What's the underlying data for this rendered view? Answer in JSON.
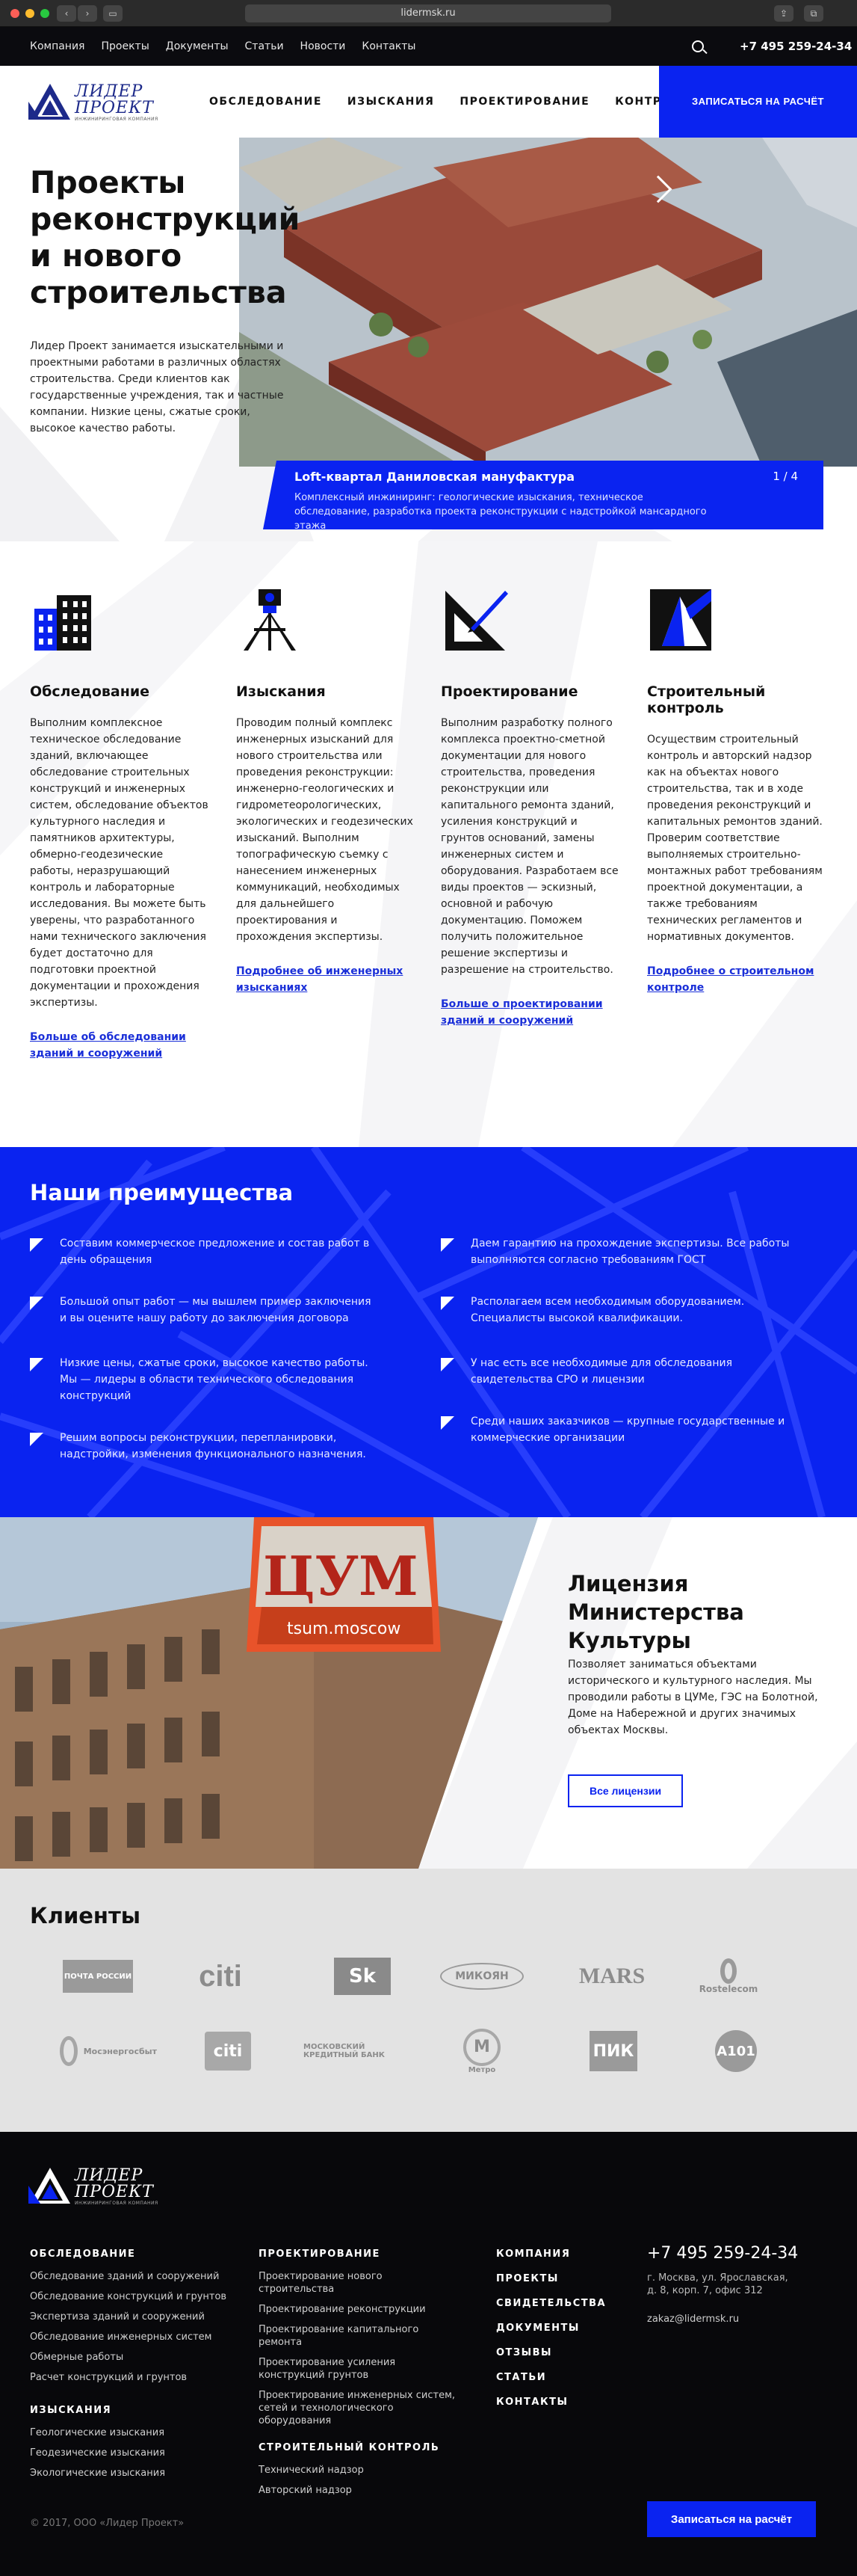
{
  "browser": {
    "url": "lidermsk.ru"
  },
  "topbar": {
    "nav": [
      "Компания",
      "Проекты",
      "Документы",
      "Статьи",
      "Новости",
      "Контакты"
    ],
    "phone": "+7 495 259-24-34"
  },
  "header": {
    "logo_line1": "ЛИДЕР",
    "logo_line2": "ПРОЕКТ",
    "logo_tagline": "ИНЖИНИРИНГОВАЯ КОМПАНИЯ",
    "nav": [
      "ОБСЛЕДОВАНИЕ",
      "ИЗЫСКАНИЯ",
      "ПРОЕКТИРОВАНИЕ",
      "КОНТРОЛЬ"
    ],
    "cta": "ЗАПИСАТЬСЯ НА РАСЧЁТ"
  },
  "hero": {
    "title": "Проекты реконструкций и нового строительства",
    "text": "Лидер Проект занимается изыскательными и проектными работами в различных областях строительства. Среди клиентов как государственные учреждения, так и частные компании. Низкие цены, сжатые сроки, высокое качество работы.",
    "slide_title": "Loft-квартал Даниловская мануфактура",
    "slide_counter": "1 / 4",
    "slide_text": "Комплексный инжиниринг: геологические изыскания, техническое обследование, разработка проекта реконструкции с надстройкой мансардного этажа"
  },
  "services": [
    {
      "icon": "building-icon",
      "title": "Обследование",
      "text": "Выполним комплексное техническое обследование зданий, включающее обследование строительных конструкций и инженерных систем, обследование объектов культурного наследия и памятников архитектуры, обмерно-геодезические работы, неразрушающий контроль и лабораторные исследования. Вы можете быть уверены, что разработанного нами технического заключения будет достаточно для подготовки проектной документации и прохождения экспертизы.",
      "link": "Больше об обследовании зданий и сооружений"
    },
    {
      "icon": "theodolite-icon",
      "title": "Изыскания",
      "text": "Проводим полный комплекс инженерных изысканий для нового строительства или проведения реконструкции: инженерно-геологических и гидрометеорологических, экологических и геодезических изысканий. Выполним топографическую съемку с нанесением инженерных коммуникаций, необходимых для дальнейшего проектирования и прохождения экспертизы.",
      "link": "Подробнее об инженерных изысканиях"
    },
    {
      "icon": "set-square-icon",
      "title": "Проектирование",
      "text": "Выполним разработку полного комплекса проектно-сметной документации для нового строительства, проведения реконструкции или капитального ремонта зданий, усиления конструкций и грунтов оснований, замены инженерных систем и оборудования. Разработаем все виды проектов — эскизный, основной и рабочую документацию. Поможем получить положительное решение экспертизы и разрешение на строительство.",
      "link": "Больше о проектировании зданий и сооружений"
    },
    {
      "icon": "control-icon",
      "title": "Строительный контроль",
      "text": "Осуществим строительный контроль и авторский надзор как на объектах нового строительства, так и в ходе проведения реконструкций и капитальных ремонтов зданий. Проверим соответствие выполняемых строительно-монтажных работ требованиям проектной документации, а также требованиям технических регламентов и нормативных документов.",
      "link": "Подробнее о строительном контроле"
    }
  ],
  "advantages": {
    "title": "Наши преимущества",
    "left": [
      "Составим коммерческое предложение и состав работ в день обращения",
      "Большой опыт работ — мы вышлем пример заключения и вы оцените нашу работу до заключения договора",
      "Низкие цены, сжатые сроки, высокое качество работы. Мы — лидеры в области технического обследования конструкций",
      "Решим вопросы реконструкции, перепланировки, надстройки, изменения функционального назначения."
    ],
    "right": [
      "Даем гарантию на прохождение экспертизы. Все работы выполняются согласно требованиям ГОСТ",
      "Располагаем всем необходимым оборудованием. Специалисты высокой квалификации.",
      "У нас есть все необходимые для обследования свидетельства СРО и лицензии",
      "Среди наших заказчиков — крупные государственные и коммерческие организации"
    ]
  },
  "license": {
    "title": "Лицензия Министерства Культуры",
    "text": "Позволяет заниматься объектами исторического и культурного наследия. Мы проводили работы в ЦУМе, ГЭС на Болотной, Доме на Набережной и других значимых объектах Москвы.",
    "button": "Все лицензии",
    "sign": "ЦУМ",
    "sign_sub": "tsum.moscow"
  },
  "clients": {
    "title": "Клиенты",
    "row1": [
      "ПОЧТА РОССИИ",
      "citi",
      "Sk",
      "МИКОЯН",
      "MARS",
      "Rostelecom"
    ],
    "row2": [
      "Мосэнергосбыт",
      "citi",
      "МОСКОВСКИЙ КРЕДИТНЫЙ БАНК",
      "Метро",
      "ПИК",
      "A101"
    ]
  },
  "footer": {
    "col1_h": "ОБСЛЕДОВАНИЕ",
    "col1": [
      "Обследование зданий и сооружений",
      "Обследование конструкций и грунтов",
      "Экспертиза зданий и сооружений",
      "Обследование инженерных систем",
      "Обмерные работы",
      "Расчет конструкций и грунтов"
    ],
    "col1b_h": "ИЗЫСКАНИЯ",
    "col1b": [
      "Геологические изыскания",
      "Геодезические изыскания",
      "Экологические изыскания"
    ],
    "col2_h": "ПРОЕКТИРОВАНИЕ",
    "col2": [
      "Проектирование нового строительства",
      "Проектирование реконструкции",
      "Проектирование капитального ремонта",
      "Проектирование усиления конструкций грунтов",
      "Проектирование инженерных систем, сетей и технологического оборудования"
    ],
    "col2b_h": "СТРОИТЕЛЬНЫЙ КОНТРОЛЬ",
    "col2b": [
      "Технический надзор",
      "Авторский надзор"
    ],
    "col3": [
      "КОМПАНИЯ",
      "ПРОЕКТЫ",
      "СВИДЕТЕЛЬСТВА",
      "ДОКУМЕНТЫ",
      "ОТЗЫВЫ",
      "СТАТЬИ",
      "КОНТАКТЫ"
    ],
    "phone": "+7 495 259-24-34",
    "address": "г. Москва, ул. Ярославская, д. 8, корп. 7, офис 312",
    "email": "zakaz@lidermsk.ru",
    "copyright": "© 2017, ООО «Лидер Проект»",
    "cta": "Записаться на расчёт"
  }
}
